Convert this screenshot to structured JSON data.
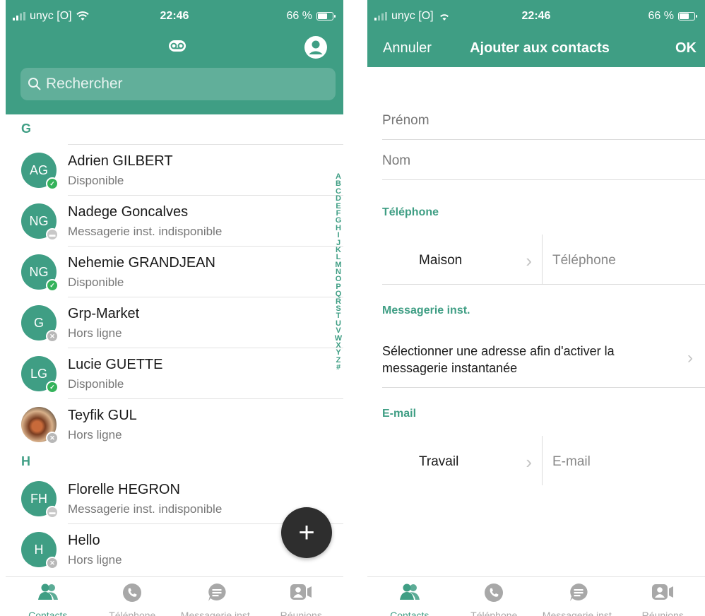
{
  "left_screen": {
    "status_bar": {
      "carrier": "unyc [O]",
      "time": "22:46",
      "battery": "66 %",
      "battery_level": 0.66
    },
    "search": {
      "placeholder": "Rechercher"
    },
    "sections": [
      {
        "letter": "G",
        "contacts": [
          {
            "initials": "AG",
            "name": "Adrien GILBERT",
            "status": "Disponible",
            "presence": "online"
          },
          {
            "initials": "NG",
            "name": "Nadege Goncalves",
            "status": "Messagerie inst. indisponible",
            "presence": "unavailable"
          },
          {
            "initials": "NG",
            "name": "Nehemie GRANDJEAN",
            "status": "Disponible",
            "presence": "online"
          },
          {
            "initials": "G",
            "name": "Grp-Market",
            "status": "Hors ligne",
            "presence": "offline"
          },
          {
            "initials": "LG",
            "name": "Lucie GUETTE",
            "status": "Disponible",
            "presence": "online"
          },
          {
            "initials": "",
            "name": "Teyfik GUL",
            "status": "Hors ligne",
            "presence": "offline",
            "photo": true
          }
        ]
      },
      {
        "letter": "H",
        "contacts": [
          {
            "initials": "FH",
            "name": "Florelle HEGRON",
            "status": "Messagerie inst. indisponible",
            "presence": "unavailable"
          },
          {
            "initials": "H",
            "name": "Hello",
            "status": "Hors ligne",
            "presence": "offline"
          }
        ]
      }
    ],
    "alpha_index": [
      "A",
      "B",
      "C",
      "D",
      "E",
      "F",
      "G",
      "H",
      "I",
      "J",
      "K",
      "L",
      "M",
      "N",
      "O",
      "P",
      "Q",
      "R",
      "S",
      "T",
      "U",
      "V",
      "W",
      "X",
      "Y",
      "Z",
      "#"
    ],
    "fab_label": "+"
  },
  "tabs": [
    {
      "label": "Contacts",
      "icon": "contacts-icon",
      "active": true
    },
    {
      "label": "Téléphone",
      "icon": "phone-icon",
      "active": false
    },
    {
      "label": "Messagerie inst.",
      "icon": "chat-icon",
      "active": false
    },
    {
      "label": "Réunions",
      "icon": "meetings-icon",
      "active": false
    }
  ],
  "right_screen": {
    "status_bar": {
      "carrier": "unyc [O]",
      "time": "22:46",
      "battery": "66 %",
      "battery_level": 0.66
    },
    "header": {
      "cancel": "Annuler",
      "title": "Ajouter aux contacts",
      "ok": "OK"
    },
    "form": {
      "first_name_placeholder": "Prénom",
      "last_name_placeholder": "Nom",
      "phone_section": "Téléphone",
      "phone_type": "Maison",
      "phone_placeholder": "Téléphone",
      "im_section": "Messagerie inst.",
      "im_select_text": "Sélectionner une adresse afin d'activer la messagerie instantanée",
      "email_section": "E-mail",
      "email_type": "Travail",
      "email_placeholder": "E-mail"
    }
  },
  "colors": {
    "accent": "#3f9e84",
    "online": "#35b35b",
    "offline": "#b8b8b8",
    "fab": "#2e2e2e"
  }
}
